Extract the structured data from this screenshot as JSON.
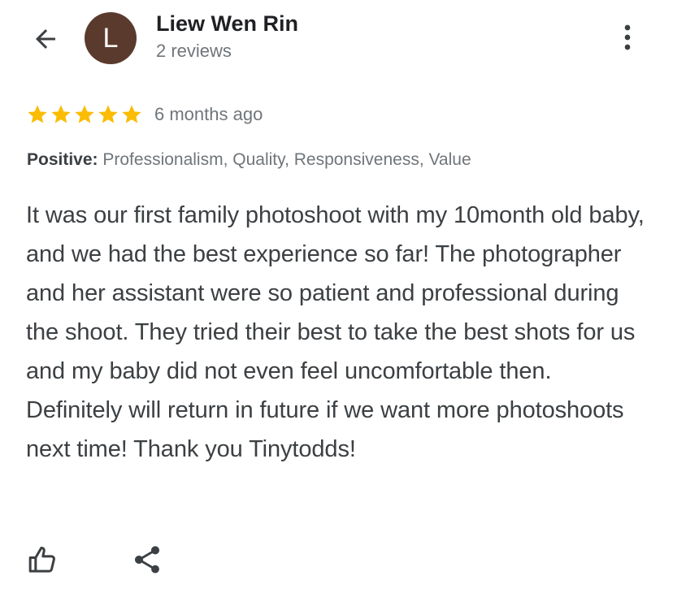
{
  "header": {
    "back_icon": "arrow-left-icon",
    "avatar_letter": "L",
    "avatar_color": "#5b3a2e",
    "user_name": "Liew Wen Rin",
    "review_count": "2 reviews",
    "more_icon": "more-vertical-icon"
  },
  "review": {
    "rating": 5,
    "rating_max": 5,
    "star_color": "#fbbc04",
    "time_ago": "6 months ago",
    "positive_label": "Positive:",
    "positive_values": "Professionalism, Quality, Responsiveness, Value",
    "text": "It was our first family photoshoot with my 10month old baby, and we had the best experience so far! The photographer and her assistant were so patient and professional during the shoot. They tried their best to take the best shots for us and my baby did not even feel uncomfortable then. Definitely will return in future if we want more photoshoots next time! Thank you Tinytodds!"
  },
  "actions": {
    "like_icon": "thumbs-up-icon",
    "share_icon": "share-icon"
  }
}
